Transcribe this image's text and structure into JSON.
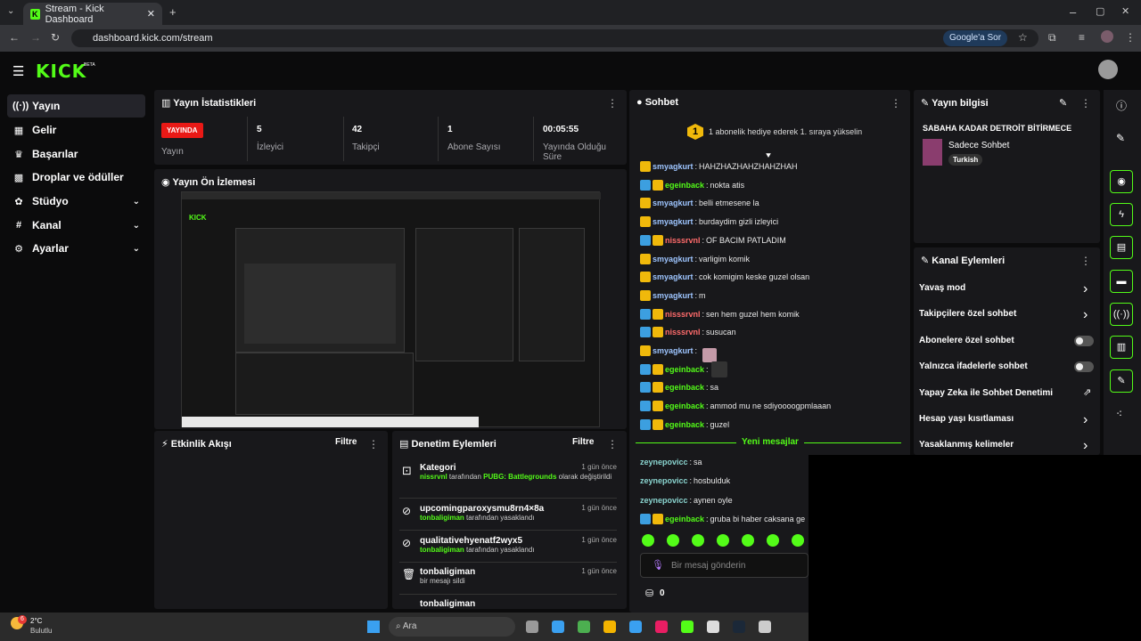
{
  "browser": {
    "tab_title": "Stream - Kick Dashboard",
    "url": "dashboard.kick.com/stream",
    "google_btn": "Google'a Sor"
  },
  "app": {
    "logo": "KICK",
    "beta": "BETA"
  },
  "sidebar": {
    "items": [
      {
        "label": "Yayın",
        "icon": "broadcast-icon"
      },
      {
        "label": "Gelir",
        "icon": "revenue-icon"
      },
      {
        "label": "Başarılar",
        "icon": "trophy-icon"
      },
      {
        "label": "Droplar ve ödüller",
        "icon": "gift-icon"
      },
      {
        "label": "Stüdyo",
        "icon": "studio-icon"
      },
      {
        "label": "Kanal",
        "icon": "channel-icon"
      },
      {
        "label": "Ayarlar",
        "icon": "settings-icon"
      }
    ]
  },
  "stats": {
    "title": "Yayın İstatistikleri",
    "live_badge": "YAYINDA",
    "live_label": "Yayın",
    "items": [
      {
        "value": "5",
        "label": "İzleyici"
      },
      {
        "value": "42",
        "label": "Takipçi"
      },
      {
        "value": "1",
        "label": "Abone Sayısı"
      },
      {
        "value": "00:05:55",
        "label": "Yayında Olduğu Süre"
      }
    ]
  },
  "preview": {
    "title": "Yayın Ön İzlemesi"
  },
  "activity": {
    "title": "Etkinlik Akışı",
    "filter": "Filtre"
  },
  "moderation": {
    "title": "Denetim Eylemleri",
    "filter": "Filtre",
    "items": [
      {
        "title": "Kategori",
        "user": "nissrvnl",
        "text": " tarafından ",
        "highlight": "PUBG: Battlegrounds",
        "tail": " olarak değiştirildi",
        "time": "1 gün önce"
      },
      {
        "title": "upcomingparoxysmu8rn4×8a",
        "user": "tonbaligiman",
        "text": " tarafından yasaklandı",
        "time": "1 gün önce"
      },
      {
        "title": "qualitativehyenatf2wyx5",
        "user": "tonbaligiman",
        "text": " tarafından yasaklandı",
        "time": "1 gün önce"
      },
      {
        "title": "tonbaligiman",
        "user": "",
        "text": "bir mesajı sildi",
        "time": "1 gün önce"
      },
      {
        "title": "tonbaligiman",
        "user": "",
        "text": "",
        "time": ""
      }
    ]
  },
  "chat": {
    "title": "Sohbet",
    "pinned": "1 abonelik hediye ederek 1. sıraya yükselin",
    "pinned_rank": "1",
    "new_messages": "Yeni mesajlar",
    "input_placeholder": "Bir mesaj gönderin",
    "points": "0",
    "messages": [
      {
        "user": "smyagkurt",
        "text": "HAHZHAZHAHZHAHZHAH",
        "badges": [
          "y"
        ],
        "color": "un-l"
      },
      {
        "user": "egeinback",
        "text": "nokta atis",
        "badges": [
          "b",
          "y"
        ],
        "color": "un-g"
      },
      {
        "user": "smyagkurt",
        "text": "belli etmesene la",
        "badges": [
          "y"
        ],
        "color": "un-l"
      },
      {
        "user": "smyagkurt",
        "text": "burdaydim gizli izleyici",
        "badges": [
          "y"
        ],
        "color": "un-l"
      },
      {
        "user": "nisssrvnl",
        "text": "OF BACIM PATLADIM",
        "badges": [
          "b",
          "y"
        ],
        "color": "un-r"
      },
      {
        "user": "smyagkurt",
        "text": "varligim komik",
        "badges": [
          "y"
        ],
        "color": "un-l"
      },
      {
        "user": "smyagkurt",
        "text": "cok komigim keske guzel olsan",
        "badges": [
          "y"
        ],
        "color": "un-l"
      },
      {
        "user": "smyagkurt",
        "text": "m",
        "badges": [
          "y"
        ],
        "color": "un-l"
      },
      {
        "user": "nisssrvnl",
        "text": "sen hem guzel hem komik",
        "badges": [
          "b",
          "y"
        ],
        "color": "un-r"
      },
      {
        "user": "nisssrvnl",
        "text": "susucan",
        "badges": [
          "b",
          "y"
        ],
        "color": "un-r"
      },
      {
        "user": "smyagkurt",
        "text": "",
        "badges": [
          "y"
        ],
        "color": "un-l"
      },
      {
        "user": "egeinback",
        "text": "",
        "badges": [
          "b",
          "y"
        ],
        "color": "un-g"
      },
      {
        "user": "egeinback",
        "text": "sa",
        "badges": [
          "b",
          "y"
        ],
        "color": "un-g"
      },
      {
        "user": "egeinback",
        "text": "ammod mu ne sdiyoooogpmlaaan",
        "badges": [
          "b",
          "y"
        ],
        "color": "un-g"
      },
      {
        "user": "egeinback",
        "text": "guzel",
        "badges": [
          "b",
          "y"
        ],
        "color": "un-g"
      }
    ],
    "new": [
      {
        "user": "zeynepovicc",
        "text": "sa",
        "badges": []
      },
      {
        "user": "zeynepovicc",
        "text": "hosbulduk",
        "badges": []
      },
      {
        "user": "zeynepovicc",
        "text": "aynen oyle",
        "badges": []
      },
      {
        "user": "egeinback",
        "text": "gruba bi haber caksana ge",
        "badges": [
          "b",
          "y"
        ]
      }
    ]
  },
  "info": {
    "title": "Yayın bilgisi",
    "stream_title": "SABAHA KADAR DETROİT BİTİRMECE",
    "category": "Sadece Sohbet",
    "tag": "Turkish"
  },
  "actions": {
    "title": "Kanal Eylemleri",
    "items": [
      {
        "label": "Yavaş mod",
        "type": "chevron"
      },
      {
        "label": "Takipçilere özel sohbet",
        "type": "chevron"
      },
      {
        "label": "Abonelere özel sohbet",
        "type": "toggle"
      },
      {
        "label": "Yalnızca ifadelerle sohbet",
        "type": "toggle"
      },
      {
        "label": "Yapay Zeka ile Sohbet Denetimi",
        "type": "external"
      },
      {
        "label": "Hesap yaşı kısıtlaması",
        "type": "chevron"
      },
      {
        "label": "Yasaklanmış kelimeler",
        "type": "chevron"
      }
    ]
  },
  "taskbar": {
    "temp": "2°C",
    "weather": "Bulutlu",
    "badge": "6",
    "search": "Ara"
  },
  "colors": {
    "accent": "#53fc18",
    "live": "#e91916",
    "panel": "#18181b"
  }
}
